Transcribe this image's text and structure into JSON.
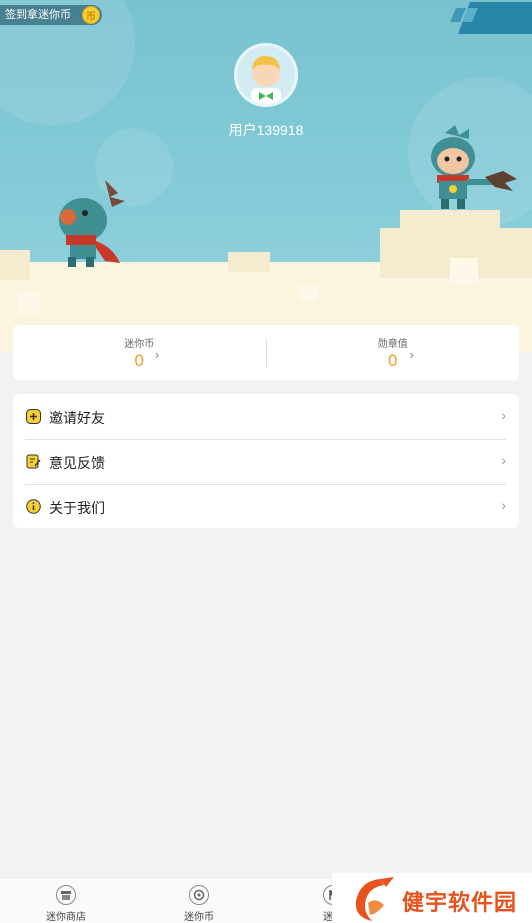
{
  "header": {
    "signin_label": "签到拿迷你币",
    "coin_icon": "coin-icon",
    "username": "用户139918"
  },
  "stats": [
    {
      "label": "迷你币",
      "value": "0"
    },
    {
      "label": "勋章值",
      "value": "0"
    }
  ],
  "menu": [
    {
      "label": "邀请好友",
      "icon": "plus-icon"
    },
    {
      "label": "意见反馈",
      "icon": "edit-icon"
    },
    {
      "label": "关于我们",
      "icon": "info-icon"
    }
  ],
  "tabbar": [
    {
      "label": "迷你商店",
      "icon": "shop-icon"
    },
    {
      "label": "迷你币",
      "icon": "coin-tab-icon"
    },
    {
      "label": "迷你",
      "icon": "flag-icon"
    }
  ],
  "watermark": {
    "text": "健宇软件园"
  },
  "colors": {
    "accent": "#f49a27",
    "sky": "#86ccd8",
    "icon_yellow": "#f6cf32"
  }
}
